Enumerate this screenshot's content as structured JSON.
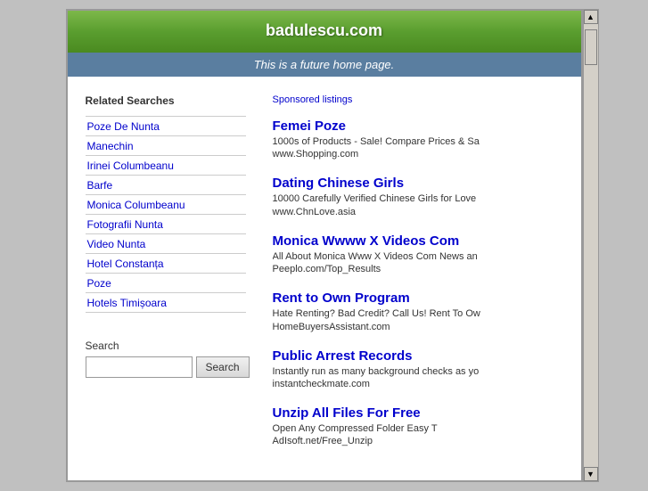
{
  "header": {
    "site_title": "badulescu.com",
    "subtitle": "This is a future home page."
  },
  "left_column": {
    "related_searches_label": "Related Searches",
    "related_searches": [
      "Poze De Nunta",
      "Manechin",
      "Irinei Columbeanu",
      "Barfe",
      "Monica Columbeanu",
      "Fotografii Nunta",
      "Video Nunta",
      "Hotel Constanța",
      "Poze",
      "Hotels Timișoara"
    ],
    "search_label": "Search",
    "search_placeholder": "",
    "search_button_label": "Search"
  },
  "right_column": {
    "sponsored_label": "Sponsored listings",
    "ads": [
      {
        "title": "Femei Poze",
        "desc": "1000s of Products - Sale! Compare Prices & Sa",
        "url": "www.Shopping.com"
      },
      {
        "title": "Dating Chinese Girls",
        "desc": "10000 Carefully Verified Chinese Girls for Love",
        "url": "www.ChnLove.asia"
      },
      {
        "title": "Monica Wwww X Videos Com",
        "desc": "All About Monica Www X Videos Com News an",
        "url": "Peeplo.com/Top_Results"
      },
      {
        "title": "Rent to Own Program",
        "desc": "Hate Renting? Bad Credit? Call Us! Rent To Ow",
        "url": "HomeBuyersAssistant.com"
      },
      {
        "title": "Public Arrest Records",
        "desc": "Instantly run as many background checks as yo",
        "url": "instantcheckmate.com"
      },
      {
        "title": "Unzip All Files For Free",
        "desc": "Open Any Compressed Folder Easy T",
        "url": "AdIsoft.net/Free_Unzip"
      }
    ]
  }
}
